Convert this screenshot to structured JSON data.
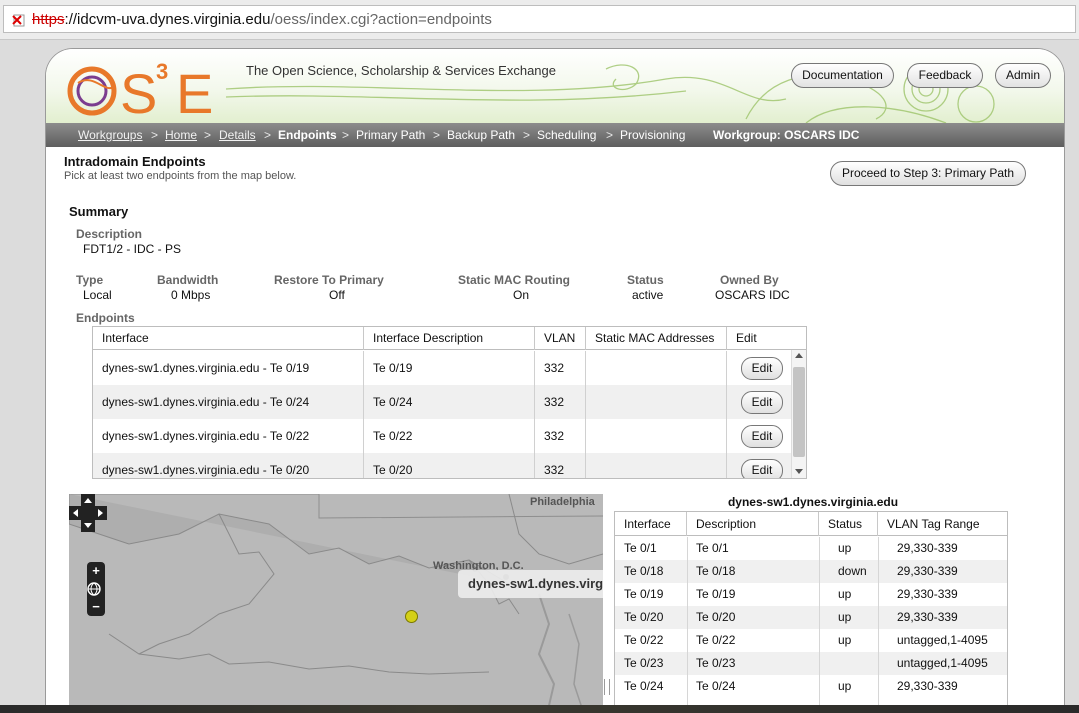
{
  "browser": {
    "url_proto": "https",
    "url_host": "://idcvm-uva.dynes.virginia.edu",
    "url_path": "/oess/index.cgi?action=endpoints"
  },
  "header": {
    "logo_text": "OS",
    "logo_sup": "3",
    "logo_e": "E",
    "tagline": "The Open Science, Scholarship & Services Exchange",
    "buttons": {
      "documentation": "Documentation",
      "feedback": "Feedback",
      "admin": "Admin"
    }
  },
  "nav": {
    "workgroups": "Workgroups",
    "home": "Home",
    "details": "Details",
    "endpoints": "Endpoints",
    "primary_path": "Primary Path",
    "backup_path": "Backup Path",
    "scheduling": "Scheduling",
    "provisioning": "Provisioning",
    "separator": ">",
    "workgroup": "Workgroup: OSCARS IDC"
  },
  "page": {
    "title": "Intradomain Endpoints",
    "subtitle": "Pick at least two endpoints from the map below.",
    "proceed_label": "Proceed to Step 3: Primary Path"
  },
  "summary": {
    "heading": "Summary",
    "description_label": "Description",
    "description": "FDT1/2 - IDC - PS",
    "type_label": "Type",
    "type": "Local",
    "bandwidth_label": "Bandwidth",
    "bandwidth": "0 Mbps",
    "restore_label": "Restore To Primary",
    "restore": "Off",
    "static_mac_label": "Static MAC Routing",
    "static_mac": "On",
    "status_label": "Status",
    "status": "active",
    "owned_label": "Owned By",
    "owned": "OSCARS IDC",
    "endpoints_label": "Endpoints"
  },
  "endpoints_table": {
    "columns": [
      "Interface",
      "Interface Description",
      "VLAN",
      "Static MAC Addresses",
      "Edit"
    ],
    "edit_label": "Edit",
    "rows": [
      {
        "interface": "dynes-sw1.dynes.virginia.edu - Te 0/19",
        "description": "Te 0/19",
        "vlan": "332",
        "mac": ""
      },
      {
        "interface": "dynes-sw1.dynes.virginia.edu - Te 0/24",
        "description": "Te 0/24",
        "vlan": "332",
        "mac": ""
      },
      {
        "interface": "dynes-sw1.dynes.virginia.edu - Te 0/22",
        "description": "Te 0/22",
        "vlan": "332",
        "mac": ""
      },
      {
        "interface": "dynes-sw1.dynes.virginia.edu - Te 0/20",
        "description": "Te 0/20",
        "vlan": "332",
        "mac": ""
      }
    ]
  },
  "map": {
    "city_philadelphia": "Philadelphia",
    "city_washington": "Washington, D.C.",
    "popup": "dynes-sw1.dynes.virg",
    "zoom_in": "+",
    "zoom_out": "−"
  },
  "device": {
    "title": "dynes-sw1.dynes.virginia.edu",
    "columns": [
      "Interface",
      "Description",
      "Status",
      "VLAN Tag Range"
    ],
    "rows": [
      {
        "interface": "Te 0/1",
        "description": "Te 0/1",
        "status": "up",
        "vlan": "29,330-339"
      },
      {
        "interface": "Te 0/18",
        "description": "Te 0/18",
        "status": "down",
        "vlan": "29,330-339"
      },
      {
        "interface": "Te 0/19",
        "description": "Te 0/19",
        "status": "up",
        "vlan": "29,330-339"
      },
      {
        "interface": "Te 0/20",
        "description": "Te 0/20",
        "status": "up",
        "vlan": "29,330-339"
      },
      {
        "interface": "Te 0/22",
        "description": "Te 0/22",
        "status": "up",
        "vlan": "untagged,1-4095"
      },
      {
        "interface": "Te 0/23",
        "description": "Te 0/23",
        "status": "",
        "vlan": "untagged,1-4095"
      },
      {
        "interface": "Te 0/24",
        "description": "Te 0/24",
        "status": "up",
        "vlan": "29,330-339"
      }
    ]
  },
  "colors": {
    "logo_orange": "#e8782a",
    "logo_purple": "#7b3d8f",
    "header_green": "#e2efcf",
    "navbar": "#6f6f6f"
  }
}
